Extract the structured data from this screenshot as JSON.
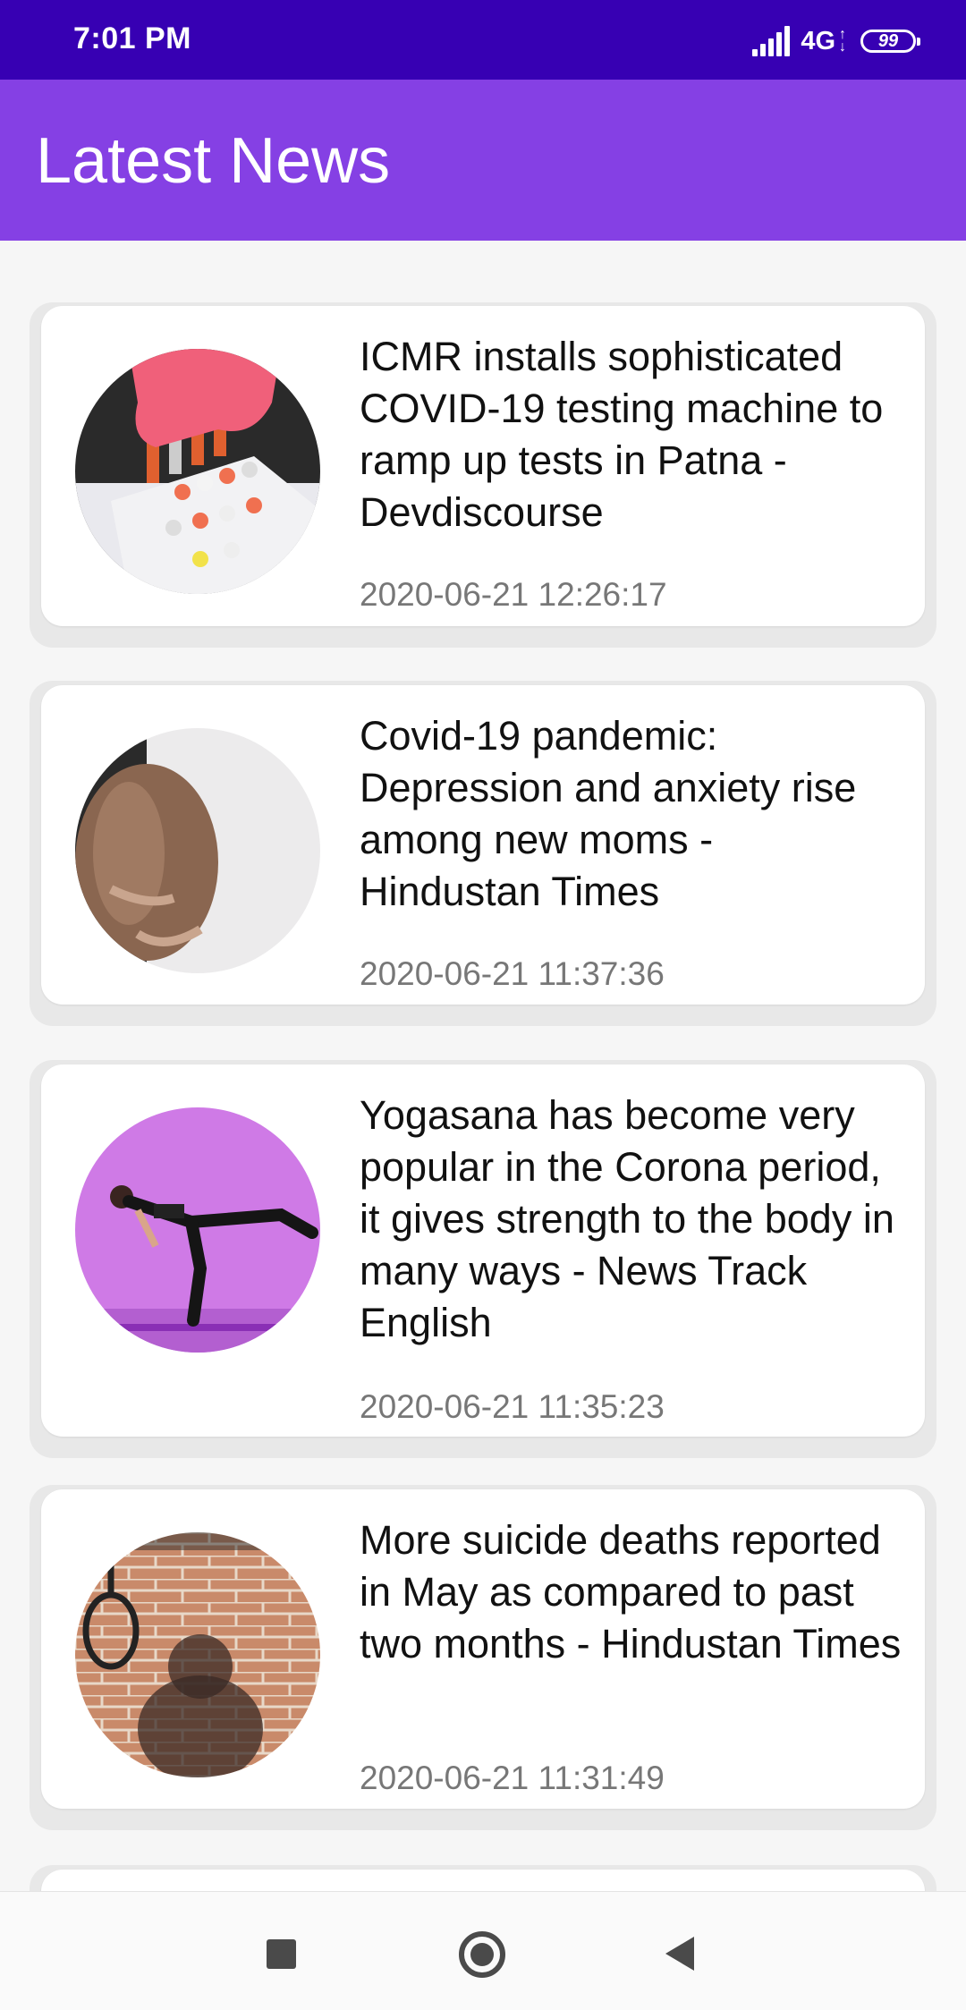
{
  "status_bar": {
    "time": "7:01 PM",
    "network": "4G",
    "battery": "99"
  },
  "app_bar": {
    "title": "Latest News",
    "color": "#8540e4"
  },
  "news": [
    {
      "title": "ICMR installs sophisticated COVID-19 testing machine to ramp up tests in Patna - Devdiscourse",
      "time": "2020-06-21 12:26:17",
      "image": "lab-test-tubes-image"
    },
    {
      "title": "Covid-19 pandemic: Depression and anxiety rise among new moms - Hindustan Times",
      "time": "2020-06-21 11:37:36",
      "image": "pregnant-woman-image"
    },
    {
      "title": "Yogasana has become very popular in the Corona period, it gives strength to the body in many ways - News Track English",
      "time": "2020-06-21 11:35:23",
      "image": "yoga-pose-image"
    },
    {
      "title": "More suicide deaths reported in May as compared to past two months - Hindustan Times",
      "time": "2020-06-21 11:31:49",
      "image": "brick-wall-noose-image"
    }
  ]
}
